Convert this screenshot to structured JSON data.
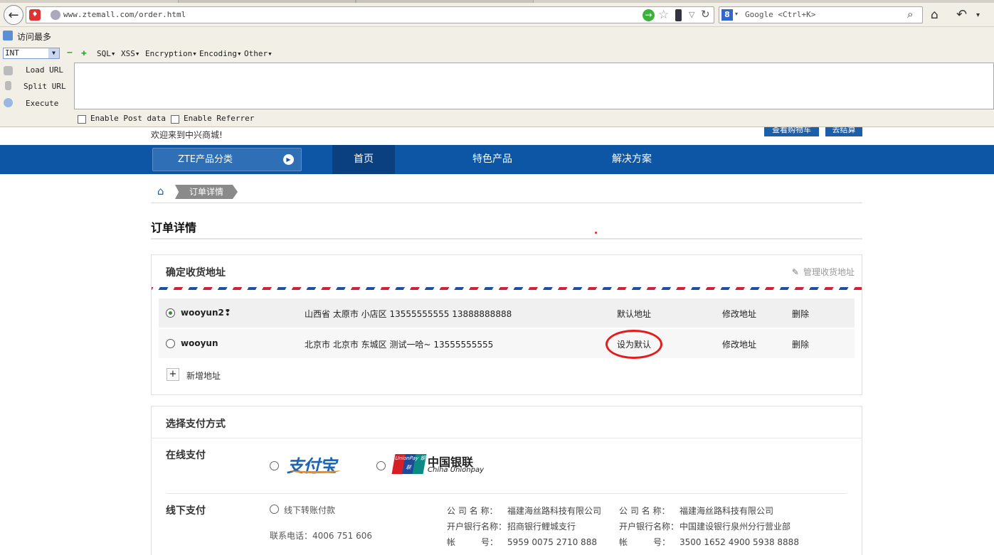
{
  "browser": {
    "url": "www.ztemall.com/order.html",
    "search_placeholder": "Google <Ctrl+K>",
    "search_engine": "8",
    "bookmark_label": "访问最多"
  },
  "hackbar": {
    "select_value": "INT",
    "menus": [
      "SQL▾",
      "XSS▾",
      "Encryption▾",
      "Encoding▾",
      "Other▾"
    ],
    "load_url": "Load URL",
    "split_url": "Split URL",
    "execute": "Execute",
    "post_label": "Enable Post data",
    "referrer_label": "Enable Referrer"
  },
  "site": {
    "welcome": "欢迎来到中兴商城!",
    "cart_label": "查看购物车",
    "checkout_label": "去结算",
    "category_label": "ZTE产品分类",
    "nav": [
      "首页",
      "特色产品",
      "解决方案"
    ],
    "brand_color": "#0d56a6"
  },
  "breadcrumb": {
    "current": "订单详情"
  },
  "page_title": "订单详情",
  "address": {
    "title": "确定收货地址",
    "manage_label": "管理收货地址",
    "rows": [
      {
        "name": "wooyun2❢",
        "address": "山西省 太原市 小店区 13555555555 13888888888",
        "default_label": "默认地址",
        "edit": "修改地址",
        "delete": "删除",
        "selected": true
      },
      {
        "name": "wooyun",
        "address": "北京市 北京市 东城区 测试一哈~ 13555555555",
        "default_label": "设为默认",
        "edit": "修改地址",
        "delete": "删除",
        "selected": false
      }
    ],
    "add_symbol": "+",
    "add_label": "新增地址"
  },
  "payment": {
    "title": "选择支付方式",
    "online_label": "在线支付",
    "alipay_logo": "支付宝",
    "unionpay_cn": "中国银联",
    "unionpay_en": "China Unionpay",
    "unionpay_mark": "UnionPay 银联",
    "offline_label": "线下支付",
    "offline_option": "线下转账付款",
    "phone": "联系电话：4006 751 606",
    "banks": [
      {
        "company_key": "公 司 名 称：",
        "company": "福建海丝路科技有限公司",
        "bank_key": "开户银行名称：",
        "bank": "招商银行鲤城支行",
        "acct_key": "帐　　　号：",
        "acct": "5959 0075 2710 888"
      },
      {
        "company_key": "公 司 名 称：",
        "company": "福建海丝路科技有限公司",
        "bank_key": "开户银行名称：",
        "bank": "中国建设银行泉州分行营业部",
        "acct_key": "帐　　　号：",
        "acct": "3500 1652 4900 5938 8888"
      }
    ]
  }
}
